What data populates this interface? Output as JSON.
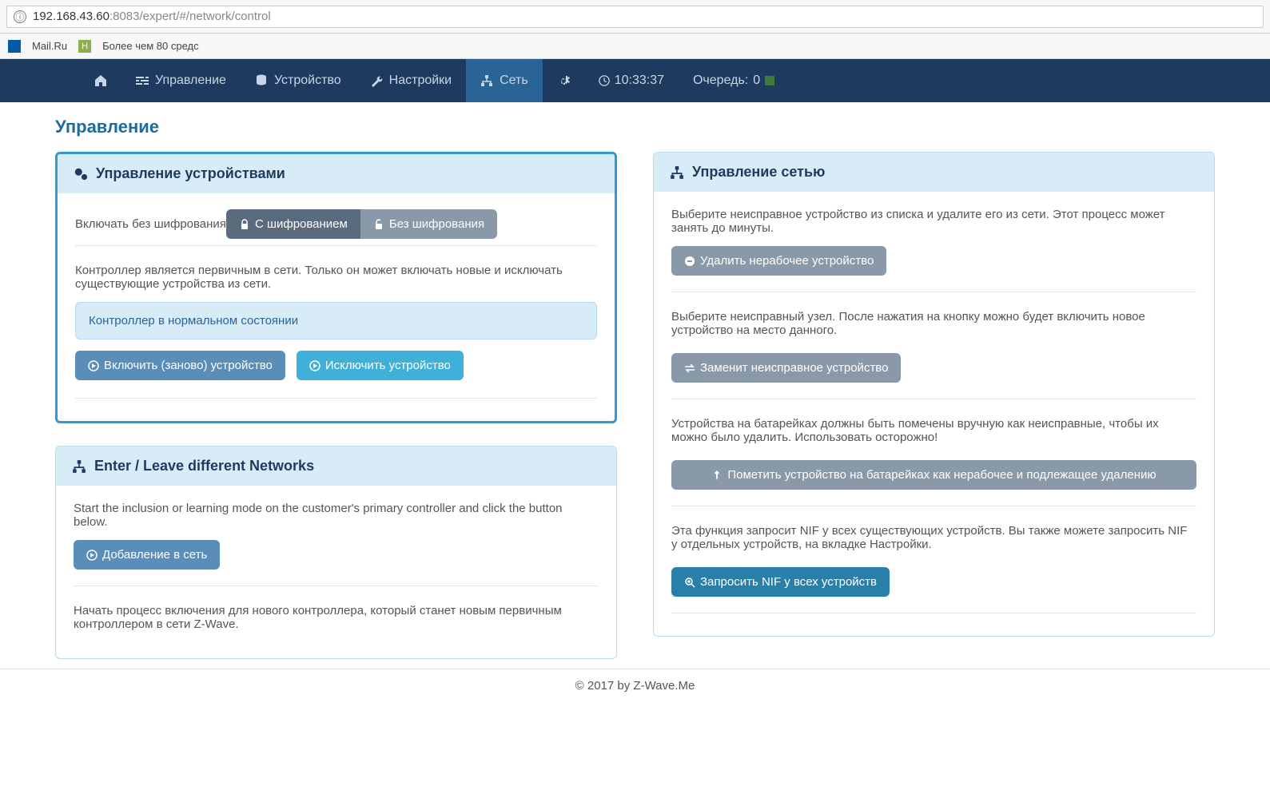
{
  "url": {
    "host": "192.168.43.60",
    "port": ":8083",
    "path": "/expert/#/network/control"
  },
  "bookmarks": [
    {
      "label": "Mail.Ru"
    },
    {
      "label": "Более чем 80 средс"
    }
  ],
  "nav": {
    "management": "Управление",
    "device": "Устройство",
    "settings": "Настройки",
    "network": "Сеть",
    "time": "10:33:37",
    "queue_label": "Очередь:",
    "queue_count": "0"
  },
  "page_title": "Управление",
  "device_mgmt": {
    "title": "Управление устройствами",
    "include_no_enc": "Включать без шифрования",
    "with_enc": "С шифрованием",
    "without_enc": "Без шифрования",
    "primary_text": "Контроллер является первичным в сети. Только он может включать новые и исключать существующие устройства из сети.",
    "state": "Контроллер в нормальном состоянии",
    "include_btn": "Включить (заново) устройство",
    "exclude_btn": "Исключить устройство"
  },
  "enter_leave": {
    "title": "Enter / Leave different Networks",
    "text1": "Start the inclusion or learning mode on the customer's primary controller and click the button below.",
    "add_btn": "Добавление в сеть",
    "text2": "Начать процесс включения для нового контроллера, который станет новым первичным контроллером в сети Z-Wave."
  },
  "net_mgmt": {
    "title": "Управление сетью",
    "remove_text": "Выберите неисправное устройство из списка и удалите его из сети. Этот процесс может занять до минуты.",
    "remove_btn": "Удалить нерабочее устройство",
    "replace_text": "Выберите неисправный узел. После нажатия на кнопку можно будет включить новое устройство на место данного.",
    "replace_btn": "Заменит неисправное устройство",
    "battery_text": "Устройства на батарейках должны быть помечены вручную как неисправные, чтобы их можно было удалить. Использовать осторожно!",
    "battery_btn": "Пометить устройство на батарейках как нерабочее и подлежащее удалению",
    "nif_text": "Эта функция запросит NIF у всех существующих устройств. Вы также можете запросить NIF у отдельных устройств, на вкладке Настройки.",
    "nif_btn": "Запросить NIF у всех устройств"
  },
  "footer": "© 2017 by Z-Wave.Me"
}
